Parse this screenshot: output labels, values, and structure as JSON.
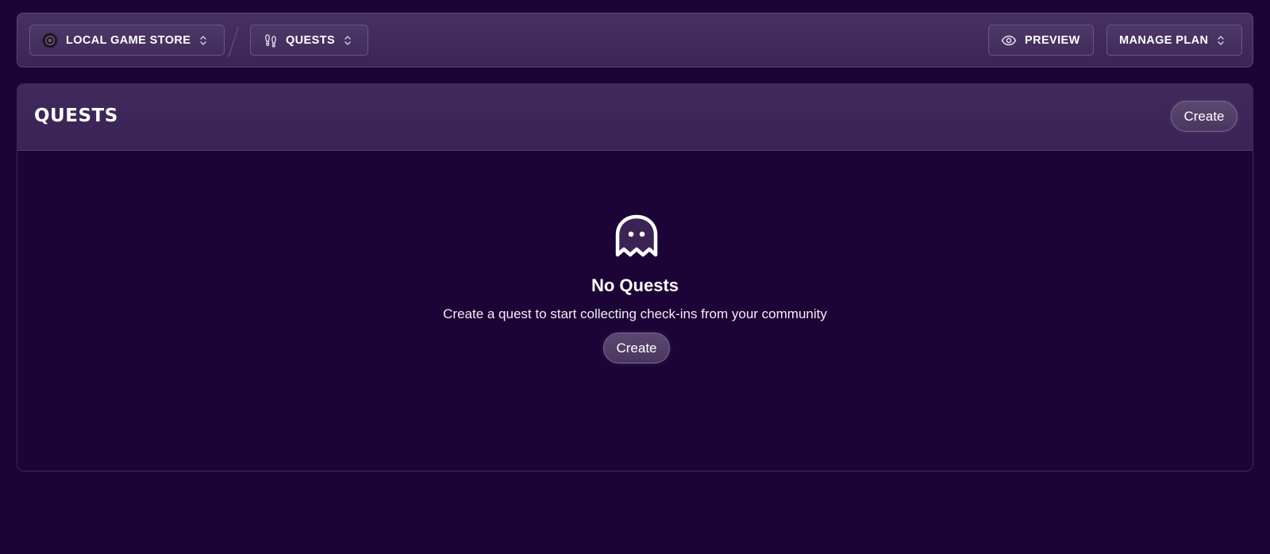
{
  "topbar": {
    "store": {
      "label": "LOCAL GAME STORE",
      "icon": "store-logo"
    },
    "section": {
      "label": "QUESTS",
      "icon": "footprints-icon"
    },
    "preview": {
      "label": "PREVIEW",
      "icon": "eye-icon"
    },
    "plan": {
      "label": "MANAGE PLAN"
    }
  },
  "panel": {
    "title": "QUESTS",
    "create_label": "Create",
    "empty": {
      "icon": "ghost-icon",
      "title": "No Quests",
      "description": "Create a quest to start collecting check-ins from your community",
      "create_label": "Create"
    }
  },
  "colors": {
    "background": "#1c0536",
    "header": "#3f2a5b",
    "button": "#4d3968"
  }
}
